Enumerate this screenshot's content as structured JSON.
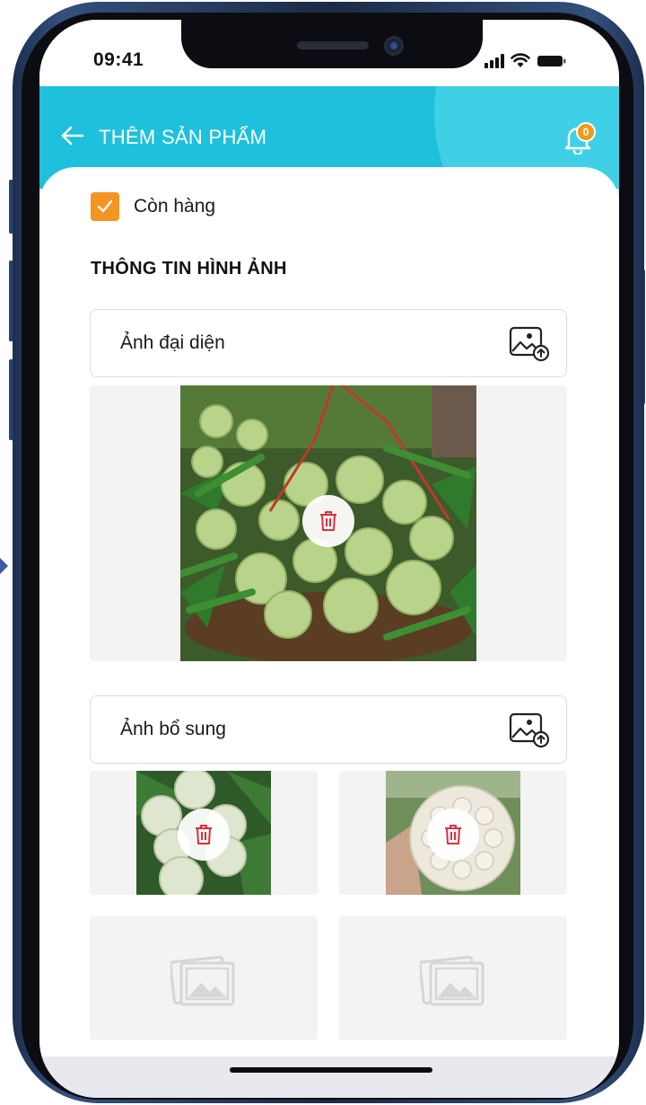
{
  "status_bar": {
    "time": "09:41",
    "icons": [
      "signal-icon",
      "wifi-icon",
      "battery-icon"
    ]
  },
  "header": {
    "title": "THÊM SẢN PHẨM",
    "back_icon": "arrow-left-icon",
    "notification_icon": "bell-icon",
    "notification_count": "0",
    "accent_color": "#1fc0dc",
    "badge_color": "#f0981a"
  },
  "form": {
    "in_stock": {
      "label": "Còn hàng",
      "checked": true,
      "color": "#f29522"
    },
    "section_title": "THÔNG TIN HÌNH ẢNH",
    "main_image": {
      "label": "Ảnh đại diện",
      "upload_icon": "image-upload-icon",
      "has_image": true,
      "delete_icon": "trash-icon"
    },
    "extra_images": {
      "label": "Ảnh bổ sung",
      "upload_icon": "image-upload-icon",
      "slots": [
        {
          "has_image": true,
          "delete_icon": "trash-icon"
        },
        {
          "has_image": true,
          "delete_icon": "trash-icon"
        },
        {
          "has_image": false,
          "placeholder_icon": "image-placeholder-icon"
        },
        {
          "has_image": false,
          "placeholder_icon": "image-placeholder-icon"
        }
      ]
    },
    "delete_color": "#d9303a"
  }
}
